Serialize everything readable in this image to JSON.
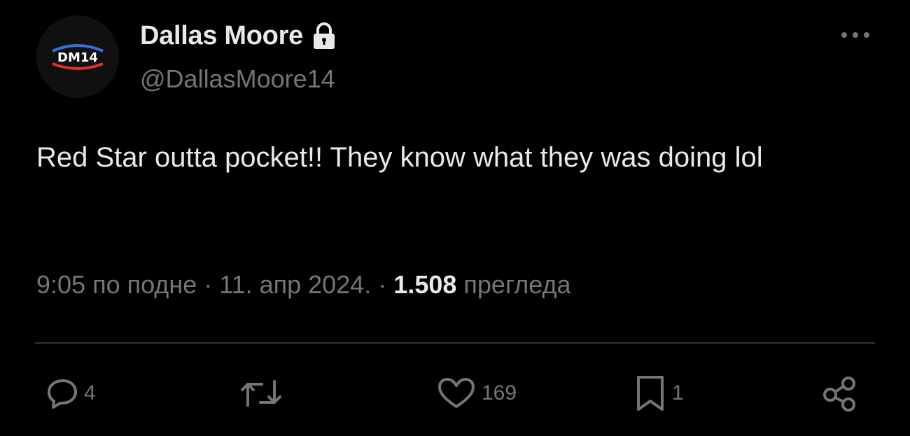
{
  "author": {
    "display_name": "Dallas Moore",
    "handle": "@DallasMoore14",
    "avatar_text": "DM14",
    "protected_icon": "lock-icon"
  },
  "tweet": {
    "text": "Red Star outta pocket!! They know what they was doing lol",
    "time": "9:05 по подне",
    "separator": "·",
    "date": "11. апр 2024.",
    "views_count": "1.508",
    "views_label": "прегледа"
  },
  "actions": {
    "replies": {
      "icon": "reply-icon",
      "count": "4"
    },
    "retweets": {
      "icon": "retweet-icon",
      "count": ""
    },
    "likes": {
      "icon": "heart-icon",
      "count": "169"
    },
    "bookmarks": {
      "icon": "bookmark-icon",
      "count": "1"
    },
    "share": {
      "icon": "share-icon"
    }
  },
  "colors": {
    "background": "#000000",
    "text_primary": "#e7e9ea",
    "text_secondary": "#71767b",
    "divider": "#2f3336",
    "avatar_blue": "#3a6fd8",
    "avatar_red": "#d8342a"
  }
}
